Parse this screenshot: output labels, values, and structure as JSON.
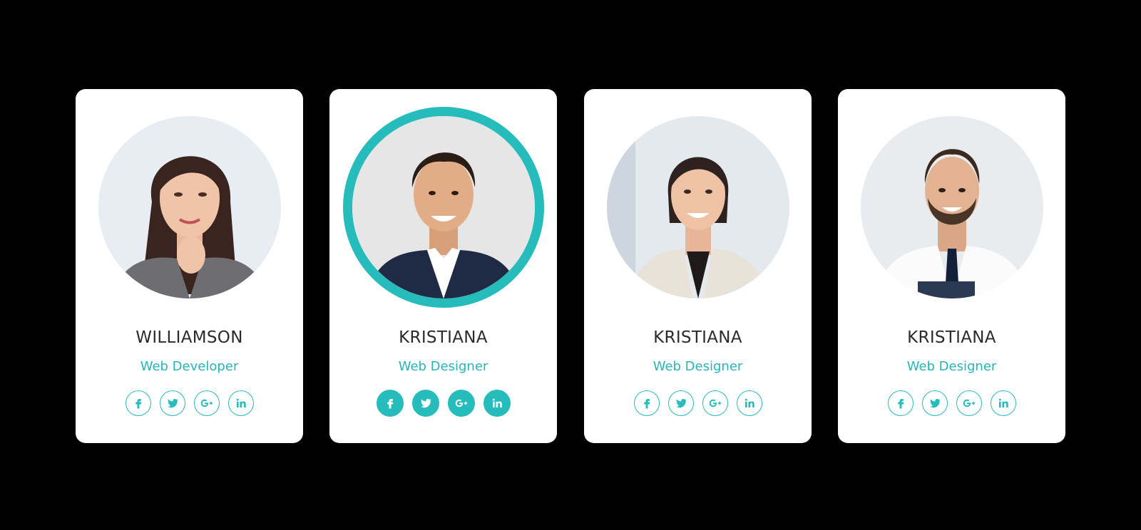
{
  "accent_color": "#27bcbc",
  "cards": [
    {
      "name": "WILLIAMSON",
      "role": "Web Developer",
      "photo": "woman-dark-hair-gray-blazer",
      "active": false,
      "socials": [
        "facebook-icon",
        "twitter-icon",
        "google-plus-icon",
        "linkedin-icon"
      ]
    },
    {
      "name": "KRISTIANA",
      "role": "Web Designer",
      "photo": "man-navy-suit",
      "active": true,
      "socials": [
        "facebook-icon",
        "twitter-icon",
        "google-plus-icon",
        "linkedin-icon"
      ]
    },
    {
      "name": "KRISTIANA",
      "role": "Web Designer",
      "photo": "woman-beige-blazer",
      "active": false,
      "socials": [
        "facebook-icon",
        "twitter-icon",
        "google-plus-icon",
        "linkedin-icon"
      ]
    },
    {
      "name": "KRISTIANA",
      "role": "Web Designer",
      "photo": "man-white-shirt-tie",
      "active": false,
      "socials": [
        "facebook-icon",
        "twitter-icon",
        "google-plus-icon",
        "linkedin-icon"
      ]
    }
  ]
}
